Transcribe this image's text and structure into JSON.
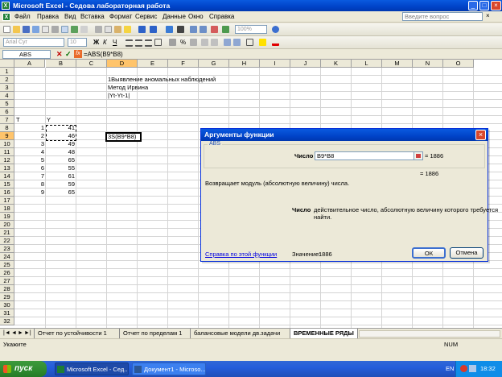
{
  "window": {
    "title": "Microsoft Excel - Седова лабораторная работа"
  },
  "menu": {
    "items": [
      "Файл",
      "Правка",
      "Вид",
      "Вставка",
      "Формат",
      "Сервис",
      "Данные",
      "Окно",
      "Справка"
    ],
    "help_placeholder": "Введите вопрос"
  },
  "toolbar": {
    "zoom": "100%",
    "font_name": "Arial Cyr",
    "font_size": "10"
  },
  "formula_bar": {
    "name_box": "ABS",
    "formula": "=ABS(B9*B8)"
  },
  "grid": {
    "columns": [
      "A",
      "B",
      "C",
      "D",
      "E",
      "F",
      "G",
      "H",
      "I",
      "J",
      "K",
      "L",
      "M",
      "N",
      "O"
    ],
    "rows": [
      "1",
      "2",
      "3",
      "4",
      "5",
      "6",
      "7",
      "8",
      "9",
      "10",
      "11",
      "12",
      "13",
      "14",
      "15",
      "16",
      "17",
      "18",
      "19",
      "20",
      "21",
      "22",
      "23",
      "24",
      "25",
      "26",
      "27",
      "28",
      "29",
      "30",
      "31",
      "32"
    ],
    "selected_column": "D",
    "selected_row": "9",
    "text_cells": {
      "d2": "1Выявление аномальных наблюдений",
      "d3": "Метод Ирвина",
      "d4": "|Yt-Yt-1|",
      "a7": "T",
      "b7": "Y",
      "d9": "3S(B9*B8)"
    },
    "data_rows": [
      {
        "t": "1",
        "y": "41"
      },
      {
        "t": "2",
        "y": "46"
      },
      {
        "t": "3",
        "y": "49"
      },
      {
        "t": "4",
        "y": "48"
      },
      {
        "t": "5",
        "y": "65"
      },
      {
        "t": "6",
        "y": "55"
      },
      {
        "t": "7",
        "y": "61"
      },
      {
        "t": "8",
        "y": "59"
      },
      {
        "t": "9",
        "y": "65"
      }
    ]
  },
  "sheet_tabs": [
    "Отчет по устойчивости 1",
    "Отчет по пределам 1",
    "балансовые модели дв.задачи",
    "ВРЕМЕННЫЕ РЯДЫ"
  ],
  "active_tab": "ВРЕМЕННЫЕ РЯДЫ",
  "status": {
    "left": "Укажите",
    "num": "NUM"
  },
  "dialog": {
    "title": "Аргументы функции",
    "function_name": "ABS",
    "arg_label": "Число",
    "arg_value": "B9*B8",
    "arg_result": "= 1886",
    "func_result": "= 1886",
    "description": "Возвращает модуль (абсолютную величину) числа.",
    "arg_help_label": "Число",
    "arg_help_text_1": "действительное число, абсолютную величину которого требуется",
    "arg_help_text_2": "найти.",
    "help_link": "Справка по этой функции",
    "value_label": "Значение:",
    "value": "1886",
    "ok_label": "ОК",
    "cancel_label": "Отмена"
  },
  "taskbar": {
    "start_label": "пуск",
    "tasks": [
      "Microsoft Excel - Сед...",
      "Документ1 - Microso..."
    ],
    "lang": "EN",
    "time": "18:32"
  },
  "colors": {
    "selection_header": "#FFC46B",
    "titlebar": "#0043C8",
    "start": "#2F8A2F"
  }
}
